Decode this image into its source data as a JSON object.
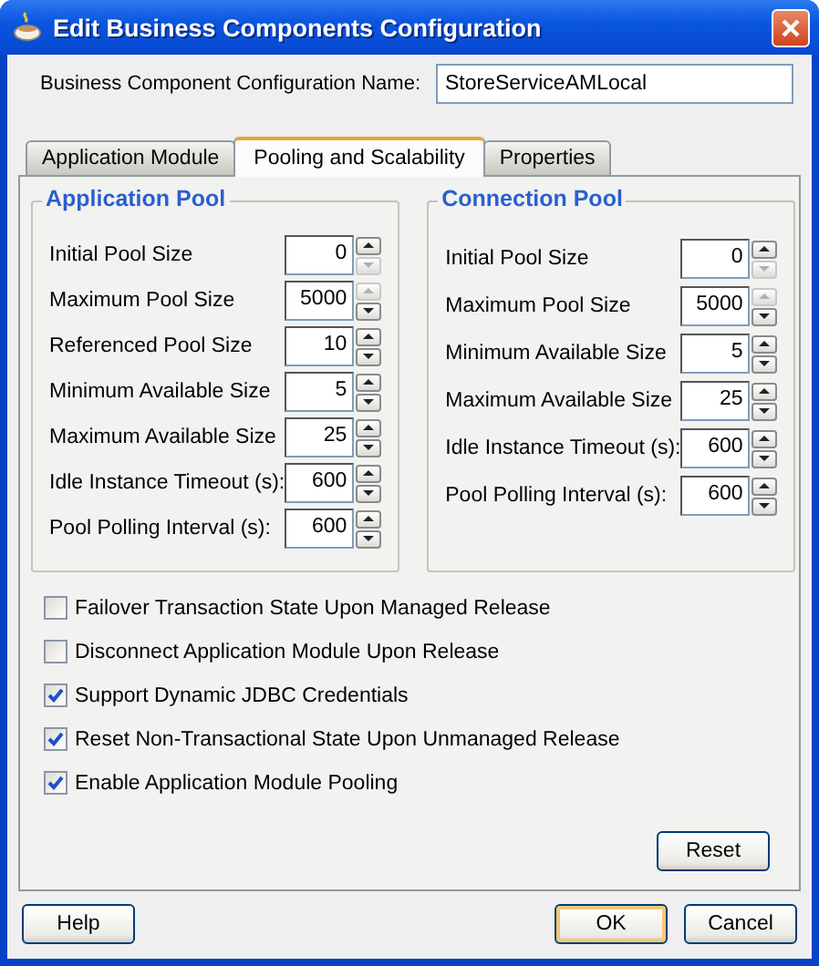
{
  "window": {
    "title": "Edit Business Components Configuration"
  },
  "config_name": {
    "label": "Business Component Configuration Name:",
    "value": "StoreServiceAMLocal"
  },
  "tabs": [
    {
      "label": "Application Module",
      "selected": false
    },
    {
      "label": "Pooling and Scalability",
      "selected": true
    },
    {
      "label": "Properties",
      "selected": false
    }
  ],
  "groups": [
    {
      "title": "Application Pool",
      "fields": [
        {
          "label": "Initial Pool Size",
          "value": "0",
          "up_disabled": false,
          "down_disabled": true
        },
        {
          "label": "Maximum Pool Size",
          "value": "5000",
          "up_disabled": true,
          "down_disabled": false
        },
        {
          "label": "Referenced Pool Size",
          "value": "10",
          "up_disabled": false,
          "down_disabled": false
        },
        {
          "label": "Minimum Available Size",
          "value": "5",
          "up_disabled": false,
          "down_disabled": false
        },
        {
          "label": "Maximum Available Size",
          "value": "25",
          "up_disabled": false,
          "down_disabled": false
        },
        {
          "label": "Idle Instance Timeout (s):",
          "value": "600",
          "up_disabled": false,
          "down_disabled": false
        },
        {
          "label": "Pool Polling Interval (s):",
          "value": "600",
          "up_disabled": false,
          "down_disabled": false
        }
      ]
    },
    {
      "title": "Connection Pool",
      "fields": [
        {
          "label": "Initial Pool Size",
          "value": "0",
          "up_disabled": false,
          "down_disabled": true
        },
        {
          "label": "Maximum Pool Size",
          "value": "5000",
          "up_disabled": true,
          "down_disabled": false
        },
        {
          "label": "Minimum Available Size",
          "value": "5",
          "up_disabled": false,
          "down_disabled": false
        },
        {
          "label": "Maximum Available Size",
          "value": "25",
          "up_disabled": false,
          "down_disabled": false
        },
        {
          "label": "Idle Instance Timeout (s):",
          "value": "600",
          "up_disabled": false,
          "down_disabled": false
        },
        {
          "label": "Pool Polling Interval (s):",
          "value": "600",
          "up_disabled": false,
          "down_disabled": false
        }
      ]
    }
  ],
  "options": [
    {
      "label": "Failover Transaction State Upon Managed Release",
      "checked": false
    },
    {
      "label": "Disconnect Application Module Upon Release",
      "checked": false
    },
    {
      "label": "Support Dynamic JDBC Credentials",
      "checked": true
    },
    {
      "label": "Reset Non-Transactional State Upon Unmanaged Release",
      "checked": true
    },
    {
      "label": "Enable Application Module Pooling",
      "checked": true
    }
  ],
  "reset_button": "Reset",
  "buttons": [
    {
      "label": "Help",
      "kind": "help"
    },
    {
      "label": "OK",
      "kind": "default"
    },
    {
      "label": "Cancel",
      "kind": "normal"
    }
  ]
}
